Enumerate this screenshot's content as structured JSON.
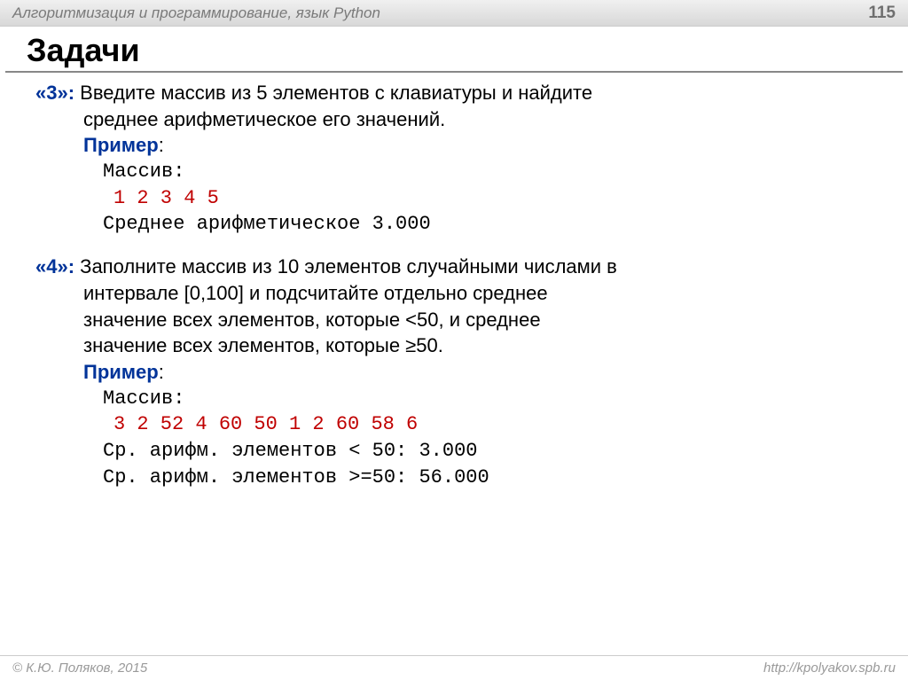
{
  "header": {
    "course": "Алгоритмизация и программирование, язык Python",
    "page": "115"
  },
  "title": "Задачи",
  "task3": {
    "label": "«3»:",
    "text_line1": " Введите массив из 5 элементов с клавиатуры и найдите",
    "text_line2": "среднее арифметическое его значений.",
    "example_label": "Пример",
    "ex_colon": ":",
    "arr_label": "Массив:",
    "arr_values": "1 2 3 4 5",
    "result": "Среднее арифметическое 3.000"
  },
  "task4": {
    "label": "«4»:",
    "text_line1": " Заполните массив из 10 элементов случайными числами в",
    "text_line2": "интервале [0,100] и подсчитайте отдельно среднее",
    "text_line3": "значение всех элементов, которые <50, и среднее",
    "text_line4": "значение всех элементов, которые ≥50.",
    "example_label": "Пример",
    "ex_colon": ":",
    "arr_label": "Массив:",
    "arr_values": "3 2 52 4 60 50 1 2 60 58 6",
    "result1": "Ср. арифм. элементов < 50: 3.000",
    "result2": "Ср. арифм. элементов >=50: 56.000"
  },
  "footer": {
    "copyright": "© К.Ю. Поляков, 2015",
    "url": "http://kpolyakov.spb.ru"
  }
}
